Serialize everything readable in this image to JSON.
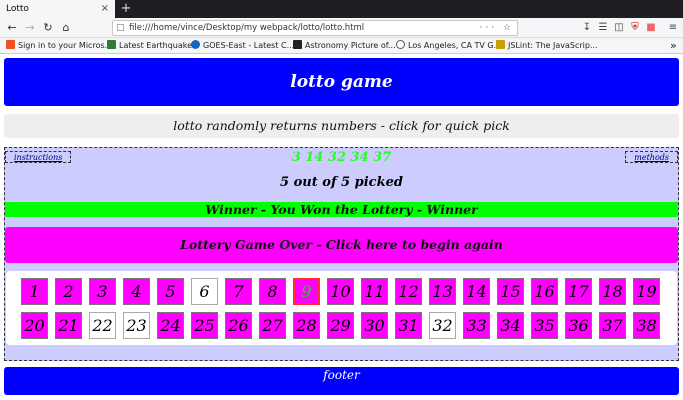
{
  "browser": {
    "tab_title": "Lotto",
    "tab_close": "×",
    "new_tab": "+",
    "url": "file:///home/vince/Desktop/my webpack/lotto/lotto.html",
    "url_actions": "··· ☆",
    "bookmarks": [
      {
        "label": "Sign in to your Micros...",
        "color": "#f25022"
      },
      {
        "label": "Latest Earthquakes",
        "color": "#2e7d32"
      },
      {
        "label": "GOES-East - Latest C...",
        "color": "#1565c0"
      },
      {
        "label": "Astronomy Picture of...",
        "color": "#222222"
      },
      {
        "label": "Los Angeles, CA TV G...",
        "color": "#555555"
      },
      {
        "label": "JSLint: The JavaScrip...",
        "color": "#c8a000"
      }
    ],
    "more": "»"
  },
  "page": {
    "header": "lotto game",
    "subtitle": "lotto randomly returns numbers - click for quick pick",
    "instructions_link": "instructions",
    "methods_link": "methods",
    "picked_numbers": "3 14 32 34 37",
    "status": "5 out of 5 picked",
    "winner_message": "Winner - You Won the Lottery - Winner",
    "gameover_message": "Lottery Game Over - Click here to begin again",
    "footer": "footer"
  },
  "colors": {
    "header_bg": "#0000ff",
    "ball_default": "#ff00ff",
    "ball_picked_bg": "#000000",
    "ball_picked_text": "#22ff22",
    "winner_bg": "#00ff00",
    "board_bg": "#ccccff"
  },
  "balls": [
    {
      "n": "1",
      "state": "default"
    },
    {
      "n": "2",
      "state": "default"
    },
    {
      "n": "3",
      "state": "picked"
    },
    {
      "n": "4",
      "state": "default"
    },
    {
      "n": "5",
      "state": "default"
    },
    {
      "n": "6",
      "state": "white"
    },
    {
      "n": "7",
      "state": "default"
    },
    {
      "n": "8",
      "state": "default"
    },
    {
      "n": "9",
      "state": "green-text"
    },
    {
      "n": "10",
      "state": "default"
    },
    {
      "n": "11",
      "state": "default"
    },
    {
      "n": "12",
      "state": "default"
    },
    {
      "n": "13",
      "state": "default"
    },
    {
      "n": "14",
      "state": "picked"
    },
    {
      "n": "15",
      "state": "default"
    },
    {
      "n": "16",
      "state": "default"
    },
    {
      "n": "17",
      "state": "default"
    },
    {
      "n": "18",
      "state": "default"
    },
    {
      "n": "19",
      "state": "default"
    },
    {
      "n": "20",
      "state": "default"
    },
    {
      "n": "21",
      "state": "default"
    },
    {
      "n": "22",
      "state": "white"
    },
    {
      "n": "23",
      "state": "white"
    },
    {
      "n": "24",
      "state": "default"
    },
    {
      "n": "25",
      "state": "default"
    },
    {
      "n": "26",
      "state": "default"
    },
    {
      "n": "27",
      "state": "default"
    },
    {
      "n": "28",
      "state": "default"
    },
    {
      "n": "29",
      "state": "default"
    },
    {
      "n": "30",
      "state": "default"
    },
    {
      "n": "31",
      "state": "default"
    },
    {
      "n": "32",
      "state": "white"
    },
    {
      "n": "33",
      "state": "default"
    },
    {
      "n": "34",
      "state": "picked"
    },
    {
      "n": "35",
      "state": "default"
    },
    {
      "n": "36",
      "state": "default"
    },
    {
      "n": "37",
      "state": "picked"
    },
    {
      "n": "38",
      "state": "default"
    }
  ]
}
